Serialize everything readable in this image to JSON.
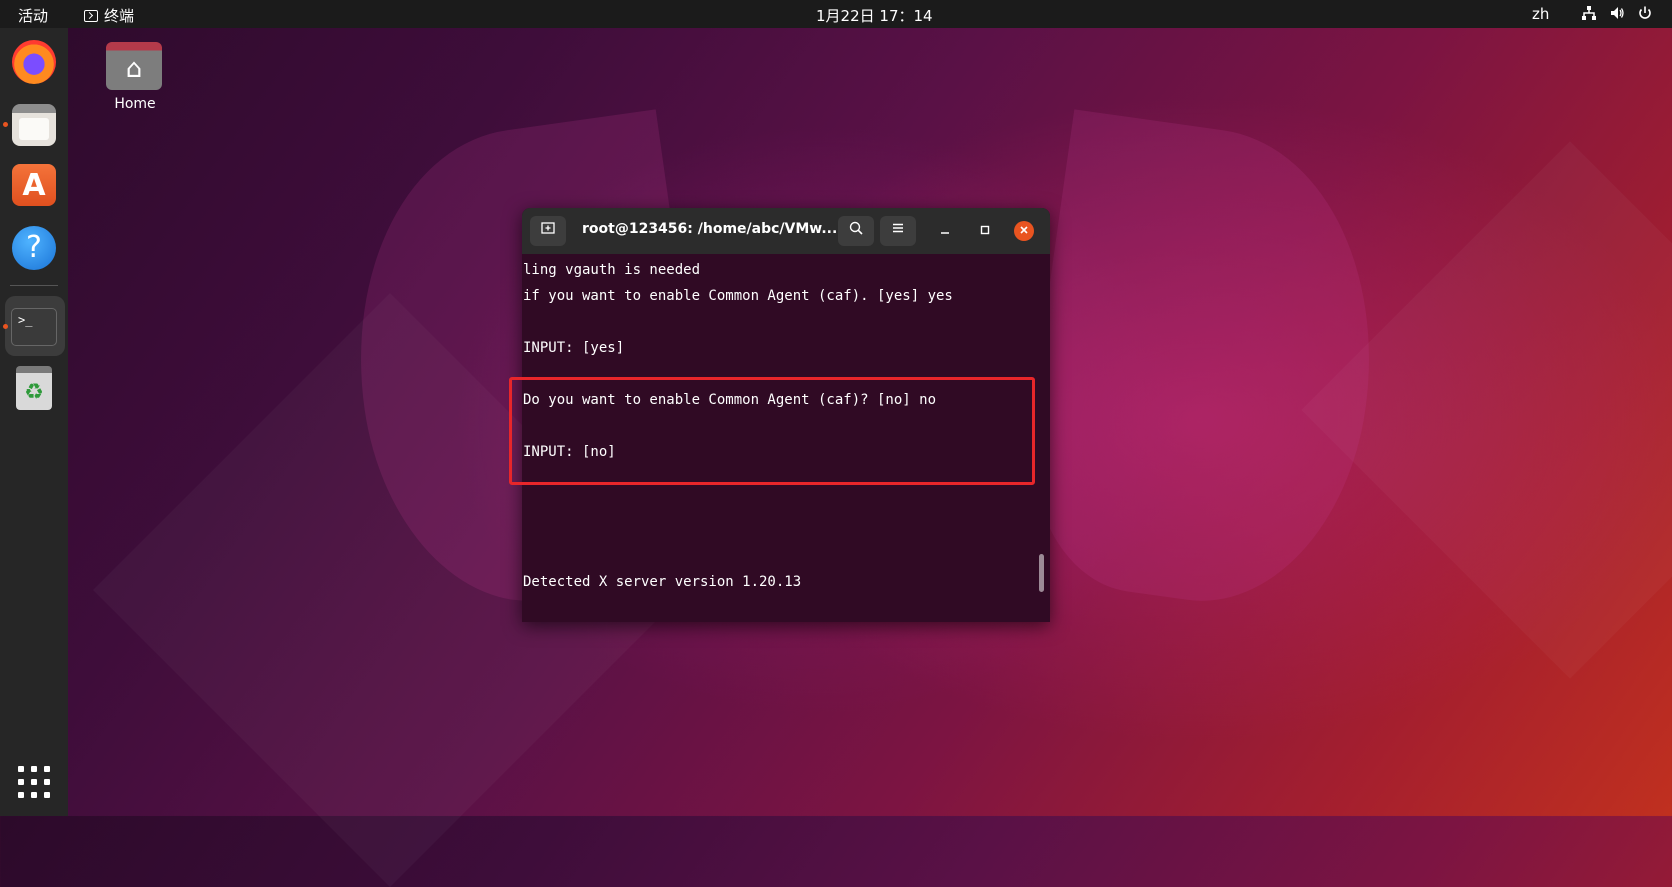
{
  "topbar": {
    "activities": "活动",
    "app_name": "终端",
    "clock": "1月22日  17：14",
    "lang": "zh"
  },
  "dock": {
    "items": [
      "firefox-icon",
      "files-icon",
      "software-store-icon",
      "help-icon",
      "terminal-icon",
      "trash-icon",
      "app-grid-icon"
    ]
  },
  "desktop": {
    "home_label": "Home"
  },
  "terminal": {
    "title": "root@123456: /home/abc/VMw...",
    "lines": [
      "ling vgauth is needed",
      "if you want to enable Common Agent (caf). [yes] yes",
      "",
      "INPUT: [yes]",
      "",
      "Do you want to enable Common Agent (caf)? [no] no",
      "",
      "INPUT: [no]",
      "",
      "",
      "",
      "",
      "Detected X server version 1.20.13"
    ]
  },
  "colors": {
    "accent": "#e95420",
    "terminal_bg": "#300a24",
    "highlight_box": "#e8262a"
  }
}
